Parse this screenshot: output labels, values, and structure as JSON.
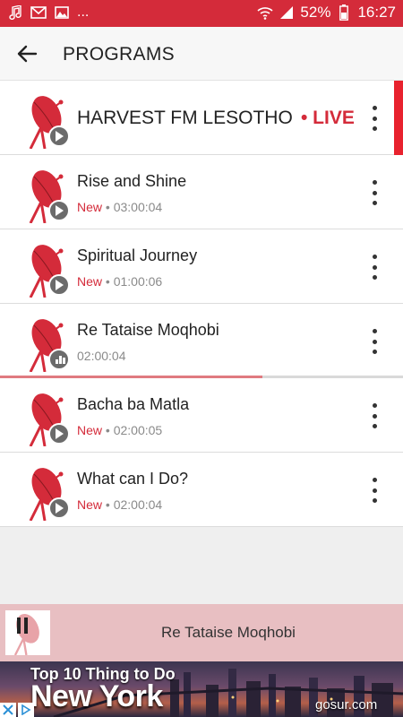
{
  "status_bar": {
    "battery": "52%",
    "time": "16:27",
    "ellipsis": "...",
    "icons": [
      "music-note-icon",
      "mail-icon",
      "image-icon",
      "wifi-icon",
      "signal-icon",
      "battery-icon"
    ]
  },
  "app_bar": {
    "title": "PROGRAMS",
    "back_icon": "arrow-left-icon"
  },
  "live": {
    "title": "HARVEST FM LESOTHO",
    "badge": "• LIVE"
  },
  "programs": [
    {
      "title": "Rise and Shine",
      "status": "New",
      "duration": "03:00:04"
    },
    {
      "title": "Spiritual Journey",
      "status": "New",
      "duration": "01:00:06"
    },
    {
      "title": "Re Tataise Moqhobi",
      "status": "",
      "duration": "02:00:04"
    },
    {
      "title": "Bacha ba Matla",
      "status": "New",
      "duration": "02:00:05"
    },
    {
      "title": "What can I Do?",
      "status": "New",
      "duration": "02:00:04"
    }
  ],
  "playback": {
    "current_progress": 0.65
  },
  "mini_player": {
    "title": "Re Tataise Moqhobi",
    "state_icon": "pause-icon"
  },
  "ad": {
    "line1": "Top 10 Thing to Do",
    "line2": "New York",
    "domain": "gosur.com"
  },
  "colors": {
    "accent": "#d42b3a",
    "live_accent": "#e8222e",
    "mini_player_bg": "#e8bfc2",
    "progress": "#e07a80"
  }
}
